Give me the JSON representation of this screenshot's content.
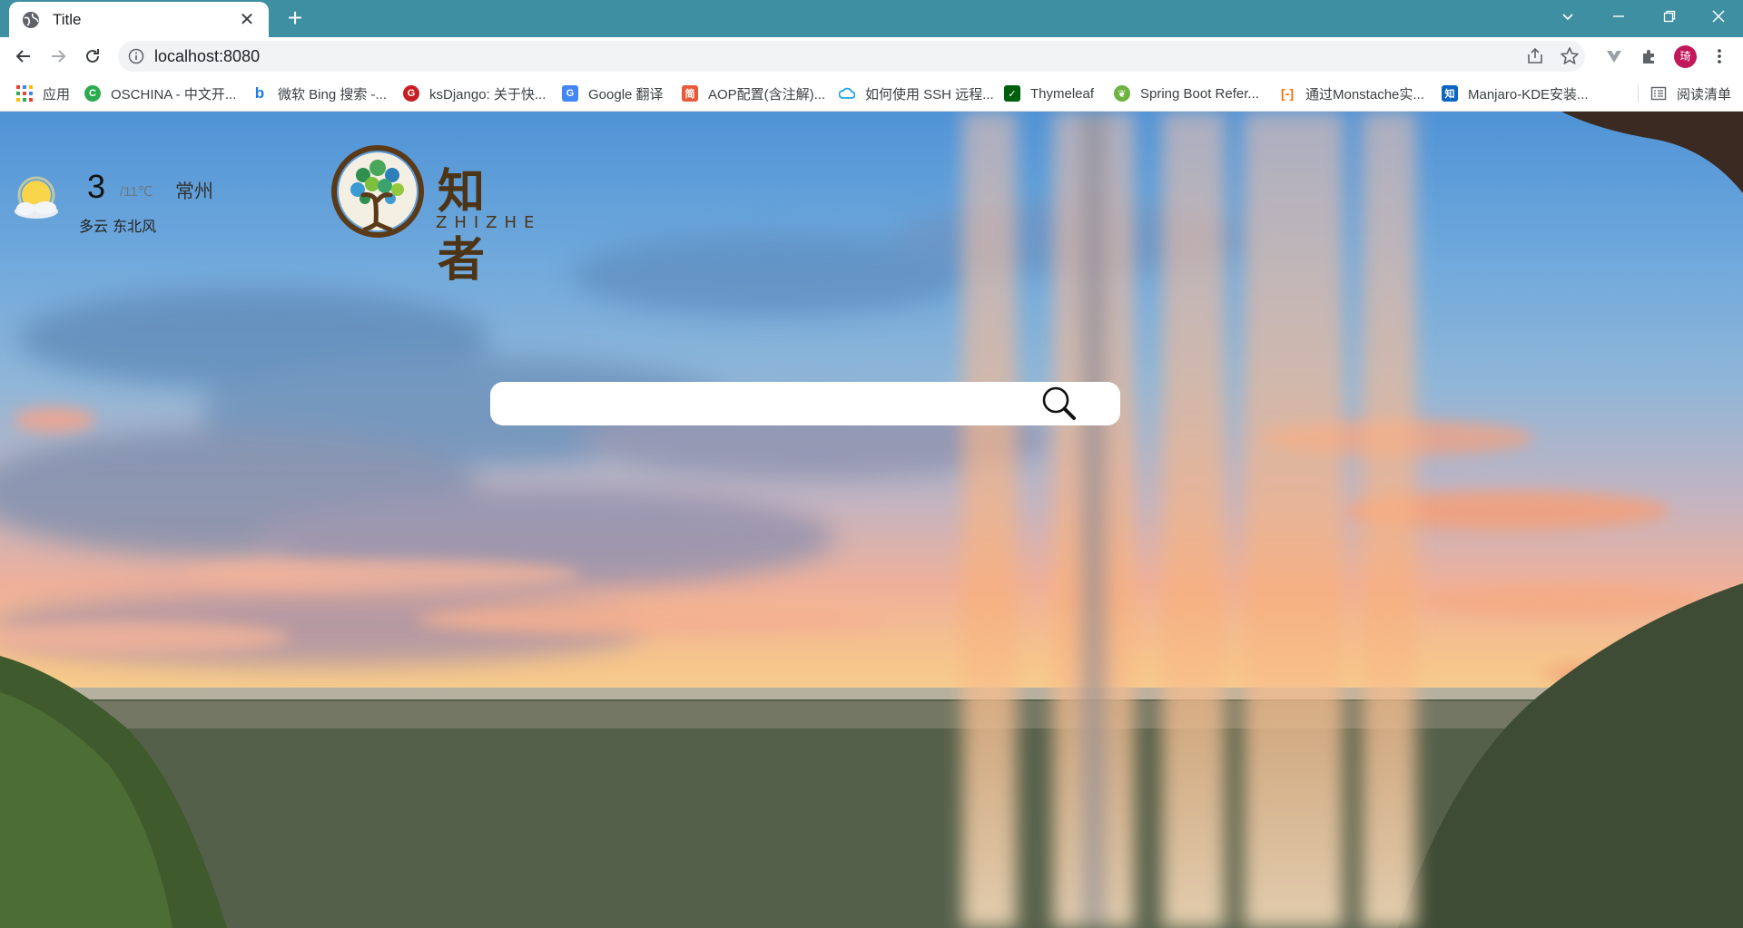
{
  "browser": {
    "tab": {
      "title": "Title"
    },
    "address": {
      "url": "localhost:8080"
    },
    "profile_initial": "琦",
    "bookmarks": [
      {
        "label": "应用",
        "icon": "apps-grid-icon",
        "color": "#4285f4"
      },
      {
        "label": "OSCHINA - 中文开...",
        "icon": "oschina-icon",
        "color": "#2daa4f"
      },
      {
        "label": "微软 Bing 搜索 -...",
        "icon": "bing-icon",
        "color": "#1d7ee0"
      },
      {
        "label": "ksDjango: 关于快...",
        "icon": "gitee-icon",
        "color": "#c71d23"
      },
      {
        "label": "Google 翻译",
        "icon": "google-translate-icon",
        "color": "#4285f4"
      },
      {
        "label": "AOP配置(含注解)...",
        "icon": "jianshu-icon",
        "color": "#e85a3a"
      },
      {
        "label": "如何使用 SSH 远程...",
        "icon": "cloud-icon",
        "color": "#1fa0e6"
      },
      {
        "label": "Thymeleaf",
        "icon": "thymeleaf-icon",
        "color": "#005f0f"
      },
      {
        "label": "Spring Boot Refer...",
        "icon": "spring-icon",
        "color": "#6db33f"
      },
      {
        "label": "通过Monstache实...",
        "icon": "aliyun-icon",
        "color": "#ff6a00"
      },
      {
        "label": "Manjaro-KDE安装...",
        "icon": "zhihu-icon",
        "color": "#0a66c2"
      }
    ],
    "reading_list": {
      "label": "阅读清单",
      "icon": "reading-list-icon"
    }
  },
  "weather": {
    "temp": "3",
    "range": "/11℃",
    "city": "常州",
    "desc": "多云 东北风",
    "icon": "partly-cloudy-icon"
  },
  "logo": {
    "cn": "知者",
    "en": "ZHIZHE"
  },
  "search": {
    "placeholder": "",
    "icon": "search-icon"
  },
  "colors": {
    "tabstrip": "#3f8fa3",
    "avatar": "#c2185b",
    "logo_brown": "#4d3416"
  }
}
